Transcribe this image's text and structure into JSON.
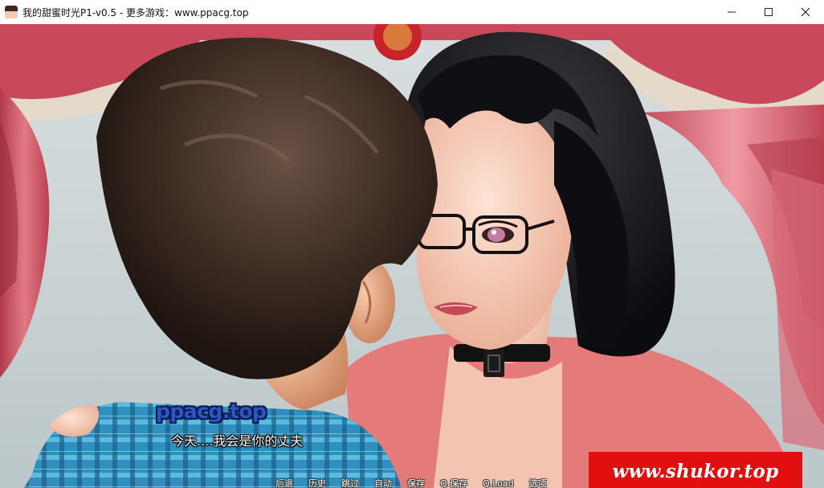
{
  "window": {
    "title": "我的甜蜜时光P1-v0.5 - 更多游戏：www.ppacg.top",
    "icon": "app-avatar-icon",
    "controls": [
      "minimize-icon",
      "maximize-icon",
      "close-icon"
    ]
  },
  "dialogue": {
    "speaker": "ppacg.top",
    "text": "今天....我会是你的丈夫"
  },
  "watermark": {
    "text": "www.shukor.top",
    "color": "#e10f10"
  },
  "quick_menu": {
    "items": [
      "后退",
      "历史",
      "跳过",
      "自动",
      "保存",
      "Q.保存",
      "Q.Load",
      "选项"
    ]
  },
  "colors": {
    "speaker": "#2a56c8",
    "curtain": "#c9485a",
    "shirt": "#3aa0c8",
    "cardigan": "#e57a7a"
  }
}
